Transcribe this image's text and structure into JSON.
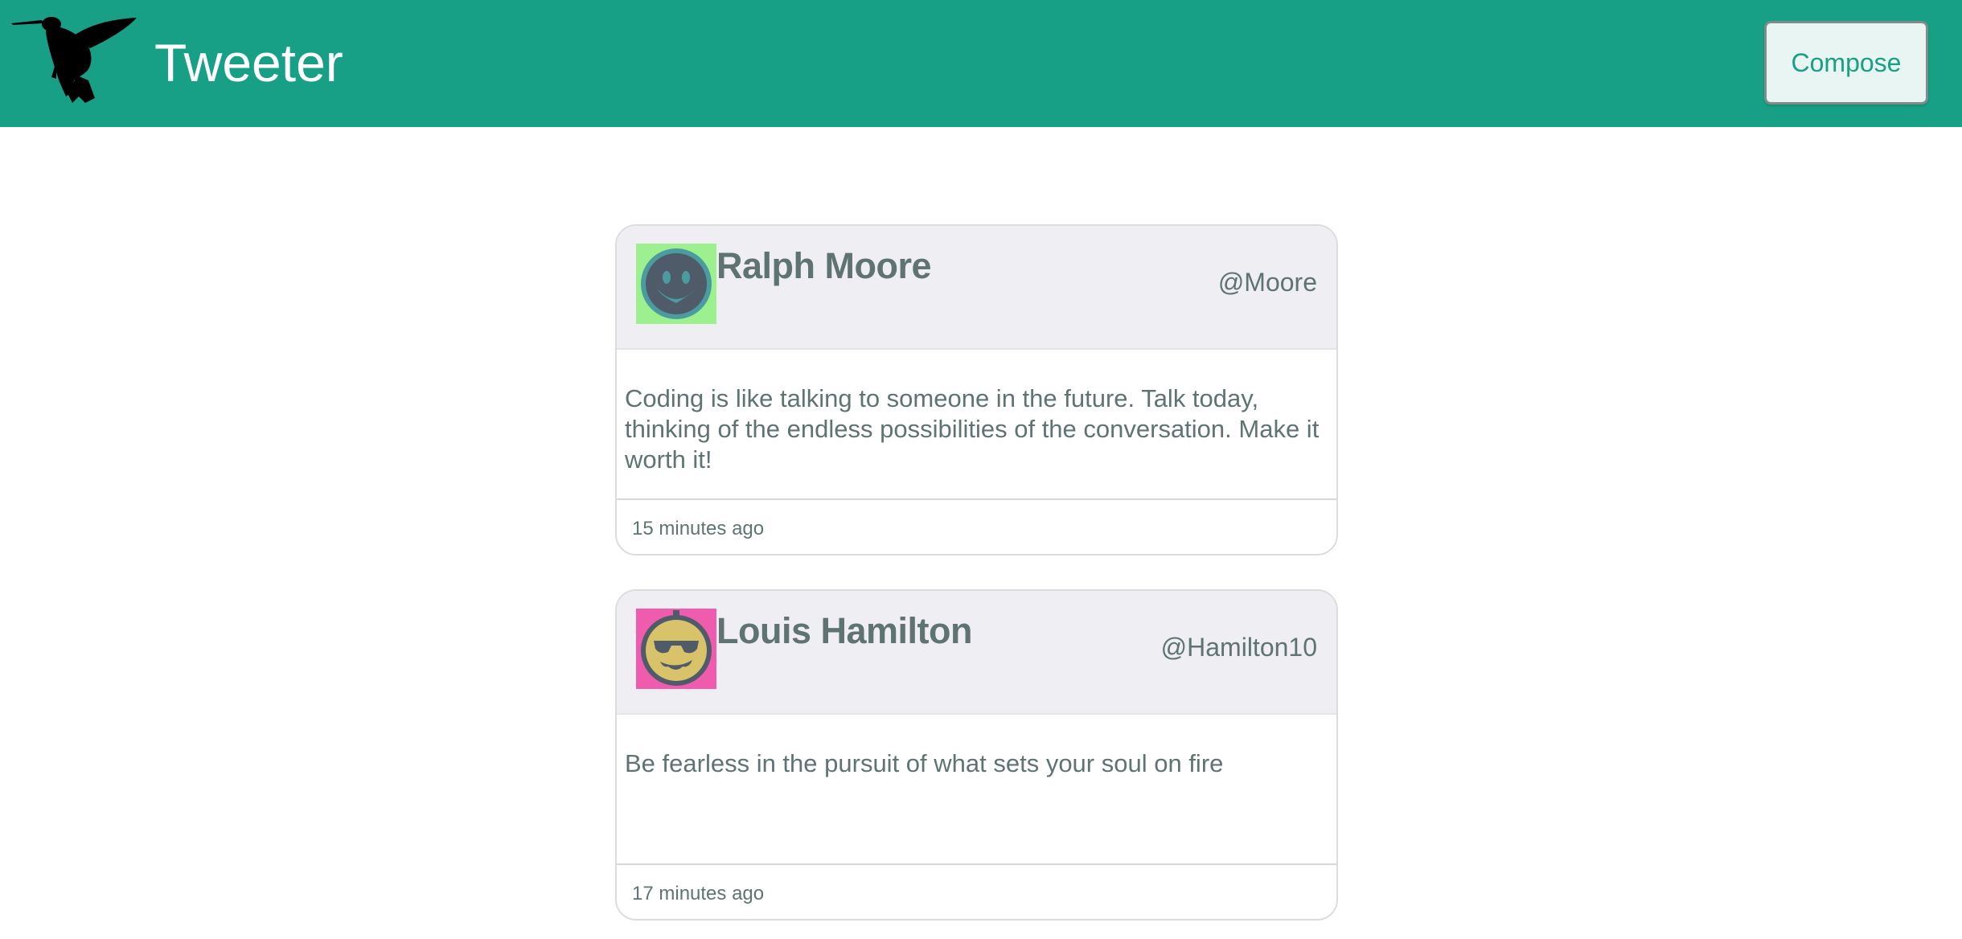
{
  "header": {
    "title": "Tweeter",
    "compose_label": "Compose",
    "logo_icon": "hummingbird-icon",
    "bg_color": "#18a086"
  },
  "tweets": [
    {
      "name": "Ralph Moore",
      "handle": "@Moore",
      "text": "Coding is like talking to someone in the future. Talk today, thinking of the endless possibilities of the conversation. Make it worth it!",
      "time": "15 minutes ago",
      "avatar_icon": "smiley-face-icon",
      "avatar_bg": "#9cf08e"
    },
    {
      "name": "Louis Hamilton",
      "handle": "@Hamilton10",
      "text": "Be fearless in the pursuit of what sets your soul on fire",
      "time": "17 minutes ago",
      "avatar_icon": "sunglasses-face-icon",
      "avatar_bg": "#ef5cae"
    }
  ]
}
